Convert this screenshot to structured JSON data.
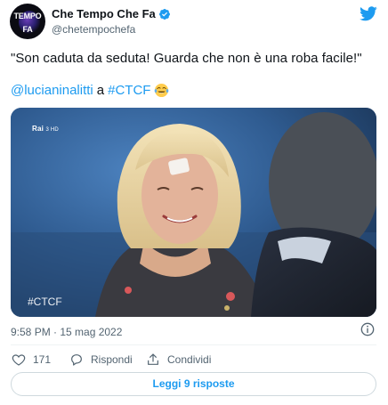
{
  "header": {
    "avatar_logo_lines": [
      "TEMPO",
      "FA"
    ],
    "display_name": "Che Tempo Che Fa",
    "handle": "@chetempochefa"
  },
  "tweet": {
    "text": "\"Son caduta da seduta! Guarda che non è una roba facile!\"",
    "mention": "@lucianinalitti",
    "connector": "a",
    "hashtag": "#CTCF",
    "emoji": "face-with-tears-of-joy"
  },
  "media": {
    "channel_badge": "Rai",
    "channel_number": "3 HD",
    "overlay_tag": "#CTCF"
  },
  "meta": {
    "timestamp": "9:58 PM · 15 mag 2022"
  },
  "actions": {
    "like_count": "171",
    "reply_label": "Rispondi",
    "share_label": "Condividi"
  },
  "replies_button": {
    "label": "Leggi 9 risposte"
  },
  "colors": {
    "accent": "#1d9bf0",
    "text": "#0f1419",
    "secondary": "#536471"
  }
}
